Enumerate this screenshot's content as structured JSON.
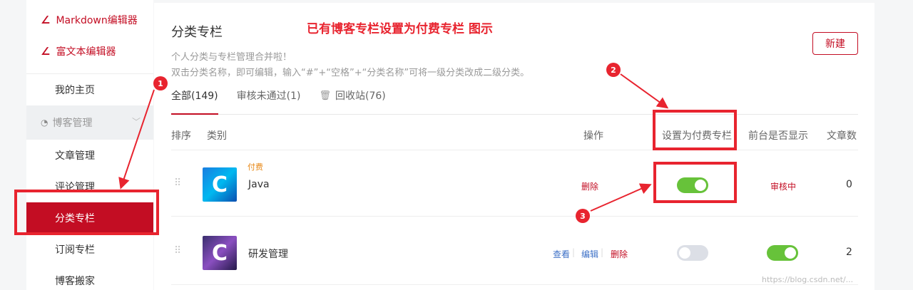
{
  "sidebar": {
    "editors": [
      {
        "label": "Markdown编辑器",
        "icon": "pen-icon"
      },
      {
        "label": "富文本编辑器",
        "icon": "pen-icon"
      }
    ],
    "home": "我的主页",
    "group": {
      "label": "博客管理",
      "icon": "blog-icon"
    },
    "items": [
      "文章管理",
      "评论管理",
      "分类专栏",
      "订阅专栏",
      "博客搬家"
    ],
    "active_index": 2
  },
  "header": {
    "title": "分类专栏",
    "demo_title": "已有博客专栏设置为付费专栏 图示",
    "new_button": "新建",
    "desc_1": "个人分类与专栏管理合并啦！",
    "desc_2": "双击分类名称，即可编辑，输入“#”+“空格”+“分类名称”可将一级分类改成二级分类。"
  },
  "tabs": [
    {
      "label": "全部(149)",
      "active": true
    },
    {
      "label": "审核未通过(1)",
      "active": false
    },
    {
      "label": "回收站(76)",
      "active": false,
      "icon": "trash-icon"
    }
  ],
  "table": {
    "columns": [
      "排序",
      "类别",
      "操作",
      "设置为付费专栏",
      "前台是否显示",
      "文章数"
    ],
    "rows": [
      {
        "tag": "付费",
        "thumb_letter": "C",
        "name": "Java",
        "actions": [
          "删除"
        ],
        "paid": true,
        "display_text": "审核中",
        "count": "0"
      },
      {
        "tag": "",
        "thumb_letter": "C",
        "name": "研发管理",
        "actions": [
          "查看",
          "编辑",
          "删除"
        ],
        "paid": false,
        "display": true,
        "count": "2"
      }
    ]
  },
  "annotations": {
    "badge_1": "1",
    "badge_2": "2",
    "badge_3": "3"
  },
  "watermark": "https://blog.csdn.net/...",
  "colors": {
    "brand": "#c30d23",
    "annotation": "#e8242f",
    "toggle_on": "#67c23a",
    "link": "#3e71c7",
    "paid_tag": "#e88a1a"
  }
}
